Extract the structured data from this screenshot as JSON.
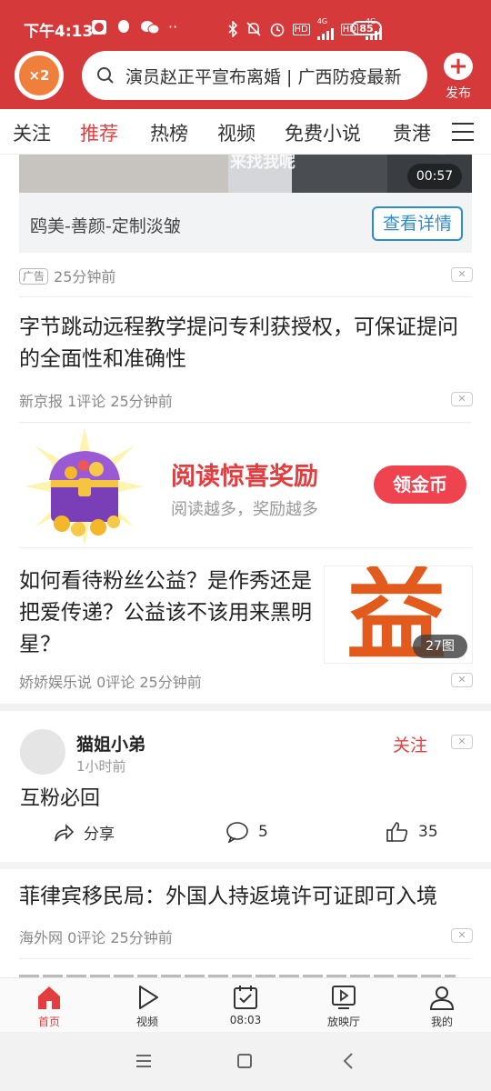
{
  "status_bar": {
    "time": "下午4:13",
    "net1": "4G",
    "net2": "4G",
    "hd": "HD",
    "battery": "85"
  },
  "header": {
    "avatar_badge": "×2",
    "search_text": "演员赵正平宣布离婚 | 广西防疫最新",
    "publish_label": "发布"
  },
  "tabs": [
    {
      "label": "关注"
    },
    {
      "label": "推荐"
    },
    {
      "label": "热榜"
    },
    {
      "label": "视频"
    },
    {
      "label": "免费小说"
    },
    {
      "label": "贵港"
    }
  ],
  "ad": {
    "video_caption": "来找我呢",
    "duration": "00:57",
    "title": "鸥美-善颜-定制淡皱",
    "button": "查看详情",
    "tag": "广告",
    "time": "25分钟前"
  },
  "feed": {
    "article1": {
      "title_line1": "字节跳动远程教学提问专利获授权，可保证提问",
      "title_line2": "的全面性和准确性",
      "meta": "新京报  1评论  25分钟前"
    },
    "reward": {
      "title": "阅读惊喜奖励",
      "subtitle": "阅读越多，奖励越多",
      "button": "领金币"
    },
    "article2": {
      "title_line1": "如何看待粉丝公益？是作秀还是",
      "title_line2": "把爱传递？公益该不该用来黑明",
      "title_line3": "星？",
      "thumb_char": "益",
      "image_count": "27图",
      "meta": "娇娇娱乐说  0评论  25分钟前"
    },
    "post": {
      "user": "猫姐小弟",
      "time": "1小时前",
      "follow": "关注",
      "text": "互粉必回",
      "share": "分享",
      "comments": "5",
      "likes": "35"
    },
    "article3": {
      "title": "菲律宾移民局：外国人持返境许可证即可入境",
      "meta": "海外网  0评论  25分钟前"
    }
  },
  "bottom_nav": [
    {
      "label": "首页"
    },
    {
      "label": "视频"
    },
    {
      "label": "08:03"
    },
    {
      "label": "放映厅"
    },
    {
      "label": "我的"
    }
  ],
  "colors": {
    "brand_red": "#d6393a",
    "accent_red": "#e33d3f",
    "link_blue": "#2e8bd0"
  }
}
